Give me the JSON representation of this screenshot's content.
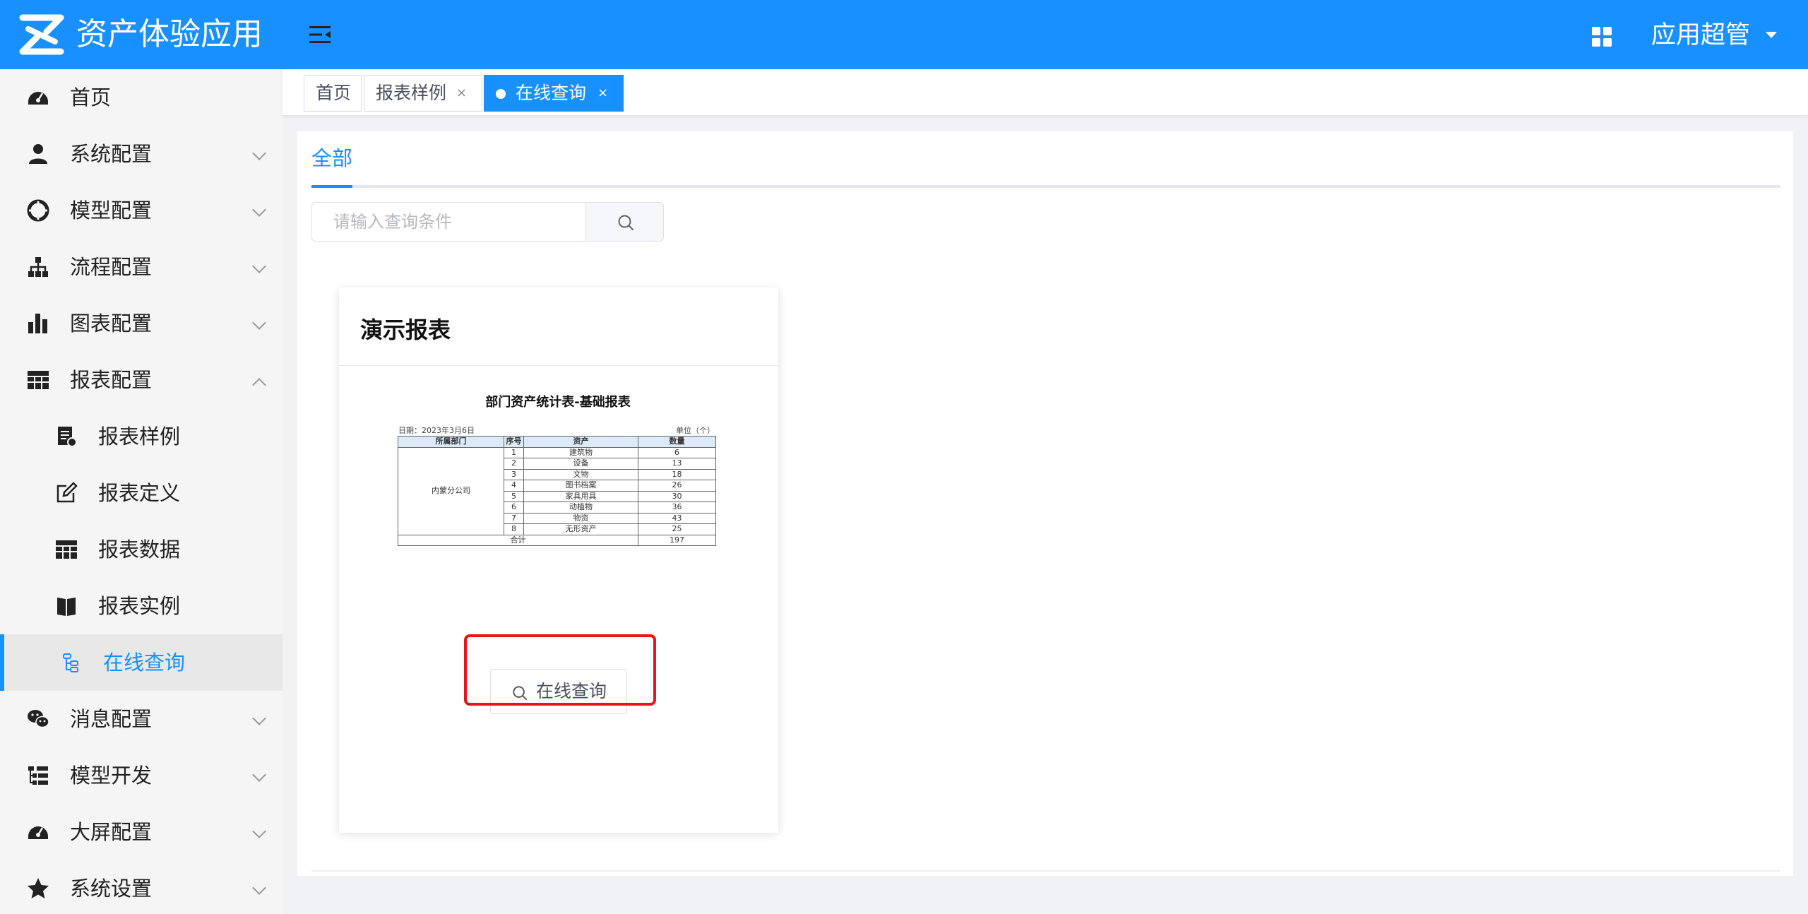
{
  "header": {
    "app_title": "资产体验应用",
    "user_name": "应用超管",
    "brand_color": "#1890ff"
  },
  "sidebar": {
    "items": [
      {
        "label": "首页",
        "icon": "dashboard-icon"
      },
      {
        "label": "系统配置",
        "icon": "user-icon"
      },
      {
        "label": "模型配置",
        "icon": "model-icon"
      },
      {
        "label": "流程配置",
        "icon": "sitemap-icon"
      },
      {
        "label": "图表配置",
        "icon": "bar-chart-icon"
      },
      {
        "label": "报表配置",
        "icon": "table-icon"
      },
      {
        "label": "消息配置",
        "icon": "wechat-icon"
      },
      {
        "label": "模型开发",
        "icon": "list-tree-icon"
      },
      {
        "label": "大屏配置",
        "icon": "dashboard-icon"
      },
      {
        "label": "系统设置",
        "icon": "star-icon"
      }
    ],
    "report_children": [
      {
        "label": "报表样例",
        "icon": "report-doc-icon"
      },
      {
        "label": "报表定义",
        "icon": "edit-icon"
      },
      {
        "label": "报表数据",
        "icon": "table-icon"
      },
      {
        "label": "报表实例",
        "icon": "book-icon"
      },
      {
        "label": "在线查询",
        "icon": "query-tree-icon"
      }
    ]
  },
  "tags": [
    {
      "label": "首页"
    },
    {
      "label": "报表样例",
      "close": "×"
    },
    {
      "label": "在线查询",
      "close": "×"
    }
  ],
  "main": {
    "tab_all": "全部",
    "search": {
      "placeholder": "请输入查询条件",
      "value": ""
    },
    "card": {
      "title": "演示报表",
      "button_label": "在线查询"
    }
  },
  "report_preview": {
    "title": "部门资产统计表-基础报表",
    "date": "日期：2023年3月6日",
    "unit": "单位（个）",
    "headers": [
      "所属部门",
      "序号",
      "资产",
      "数量"
    ],
    "department": "内蒙分公司",
    "rows": [
      {
        "no": "1",
        "asset": "建筑物",
        "qty": "6"
      },
      {
        "no": "2",
        "asset": "设备",
        "qty": "13"
      },
      {
        "no": "3",
        "asset": "文物",
        "qty": "18"
      },
      {
        "no": "4",
        "asset": "图书档案",
        "qty": "26"
      },
      {
        "no": "5",
        "asset": "家具用具",
        "qty": "30"
      },
      {
        "no": "6",
        "asset": "动植物",
        "qty": "36"
      },
      {
        "no": "7",
        "asset": "物资",
        "qty": "43"
      },
      {
        "no": "8",
        "asset": "无形资产",
        "qty": "25"
      }
    ],
    "total_label": "合计",
    "total_value": "197"
  }
}
